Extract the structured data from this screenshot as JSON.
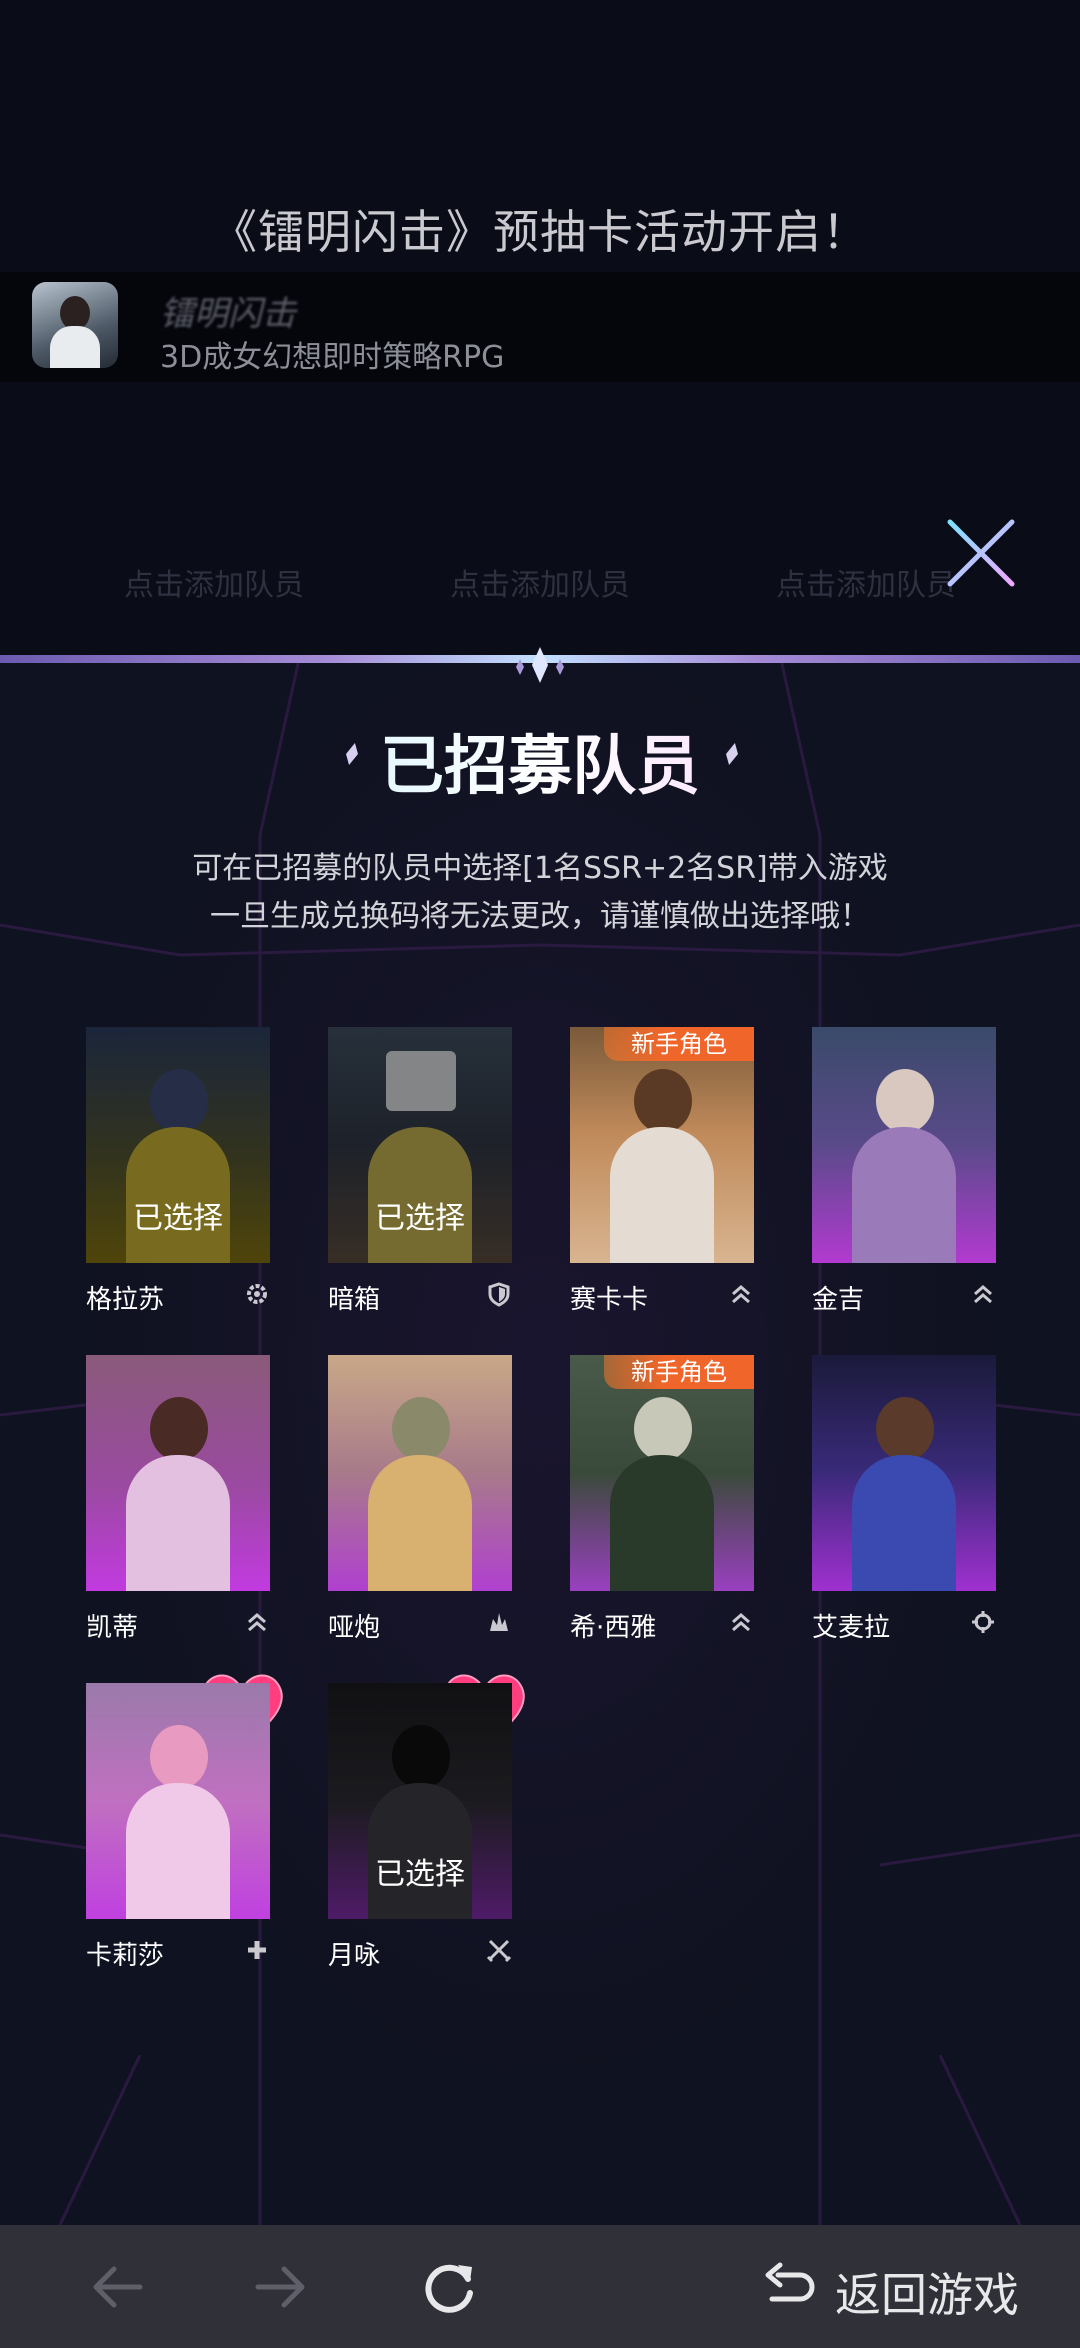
{
  "header": {
    "title": "《镭明闪击》预抽卡活动开启！",
    "app_name": "镭明闪击",
    "app_desc": "3D成女幻想即时策略RPG",
    "faded_slot_label": "点击添加队员"
  },
  "panel": {
    "title": "已招募队员",
    "subtitle_line1": "可在已招募的队员中选择[1名SSR+2名SR]带入游戏",
    "subtitle_line2": "一旦生成兑换码将无法更改，请谨慎做出选择哦！"
  },
  "labels": {
    "selected": "已选择",
    "new_role": "新手角色"
  },
  "members": [
    {
      "name": "格拉苏",
      "selected": true,
      "badge": false,
      "class_icon": "gear-icon"
    },
    {
      "name": "暗箱",
      "selected": true,
      "badge": false,
      "class_icon": "shield-icon"
    },
    {
      "name": "赛卡卡",
      "selected": false,
      "badge": true,
      "class_icon": "chevron-up-double-icon"
    },
    {
      "name": "金吉",
      "selected": false,
      "badge": false,
      "class_icon": "chevron-up-double-icon"
    },
    {
      "name": "凯蒂",
      "selected": false,
      "badge": false,
      "class_icon": "chevron-up-double-icon"
    },
    {
      "name": "哑炮",
      "selected": false,
      "badge": false,
      "class_icon": "flame-icon"
    },
    {
      "name": "希·西雅",
      "selected": false,
      "badge": true,
      "class_icon": "chevron-up-double-icon"
    },
    {
      "name": "艾麦拉",
      "selected": false,
      "badge": false,
      "class_icon": "crosshair-icon"
    },
    {
      "name": "卡莉莎",
      "selected": false,
      "badge": false,
      "class_icon": "plus-icon"
    },
    {
      "name": "月咏",
      "selected": true,
      "badge": false,
      "class_icon": "swords-icon"
    }
  ],
  "nav": {
    "back_to_game": "返回游戏"
  },
  "colors": {
    "badge": "#f0662a",
    "heart": "#ff3d7f",
    "panel_bg": "#0f1220",
    "nav_bg": "#2f3038"
  }
}
